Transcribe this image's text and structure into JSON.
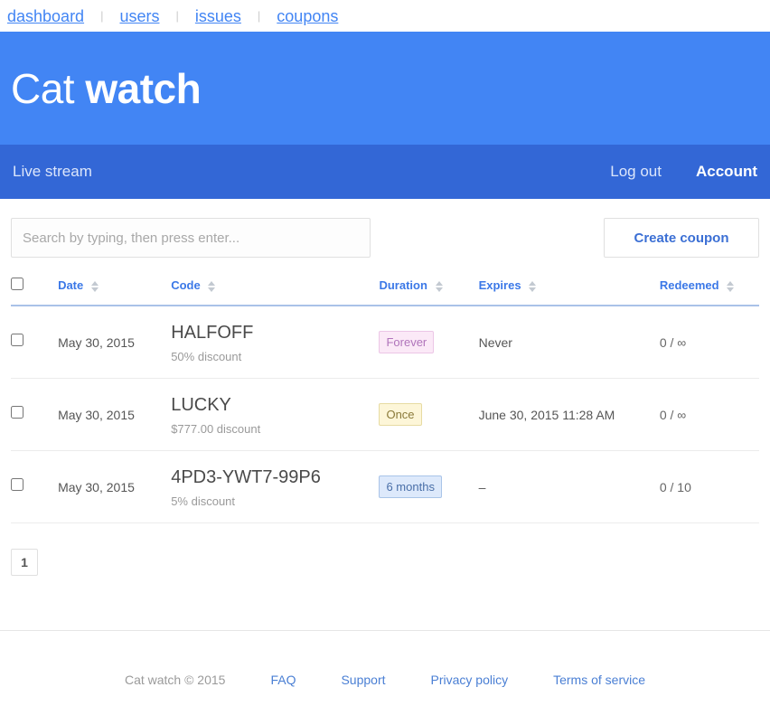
{
  "topbar": {
    "links": [
      {
        "label": "dashboard"
      },
      {
        "label": "users"
      },
      {
        "label": "issues"
      },
      {
        "label": "coupons"
      }
    ],
    "separator": "|"
  },
  "banner": {
    "brand_light": "Cat",
    "brand_bold": "watch",
    "background_color": "#4285f4"
  },
  "navbar": {
    "background_color": "#3367d6",
    "live_stream": "Live stream",
    "log_out": "Log out",
    "account": "Account"
  },
  "toolbar": {
    "search_placeholder": "Search by typing, then press enter...",
    "search_value": "",
    "create_label": "Create coupon",
    "create_color": "#3b6fd4"
  },
  "table": {
    "headers": {
      "date": "Date",
      "code": "Code",
      "duration": "Duration",
      "expires": "Expires",
      "redeemed": "Redeemed"
    },
    "header_color": "#3b78e7",
    "rows": [
      {
        "date": "May 30, 2015",
        "code": "HALFOFF",
        "discount": "50% discount",
        "duration": "Forever",
        "duration_style": "forever",
        "expires": "Never",
        "redeemed": "0 / ∞"
      },
      {
        "date": "May 30, 2015",
        "code": "LUCKY",
        "discount": "$777.00 discount",
        "duration": "Once",
        "duration_style": "once",
        "expires": "June 30, 2015 11:28 AM",
        "redeemed": "0 / ∞"
      },
      {
        "date": "May 30, 2015",
        "code": "4PD3-YWT7-99P6",
        "discount": "5% discount",
        "duration": "6 months",
        "duration_style": "months",
        "expires": "–",
        "redeemed": "0 / 10"
      }
    ]
  },
  "pagination": {
    "current_page": "1"
  },
  "footer": {
    "copyright": "Cat watch © 2015",
    "links": [
      {
        "label": "FAQ"
      },
      {
        "label": "Support"
      },
      {
        "label": "Privacy policy"
      },
      {
        "label": "Terms of service"
      }
    ]
  }
}
